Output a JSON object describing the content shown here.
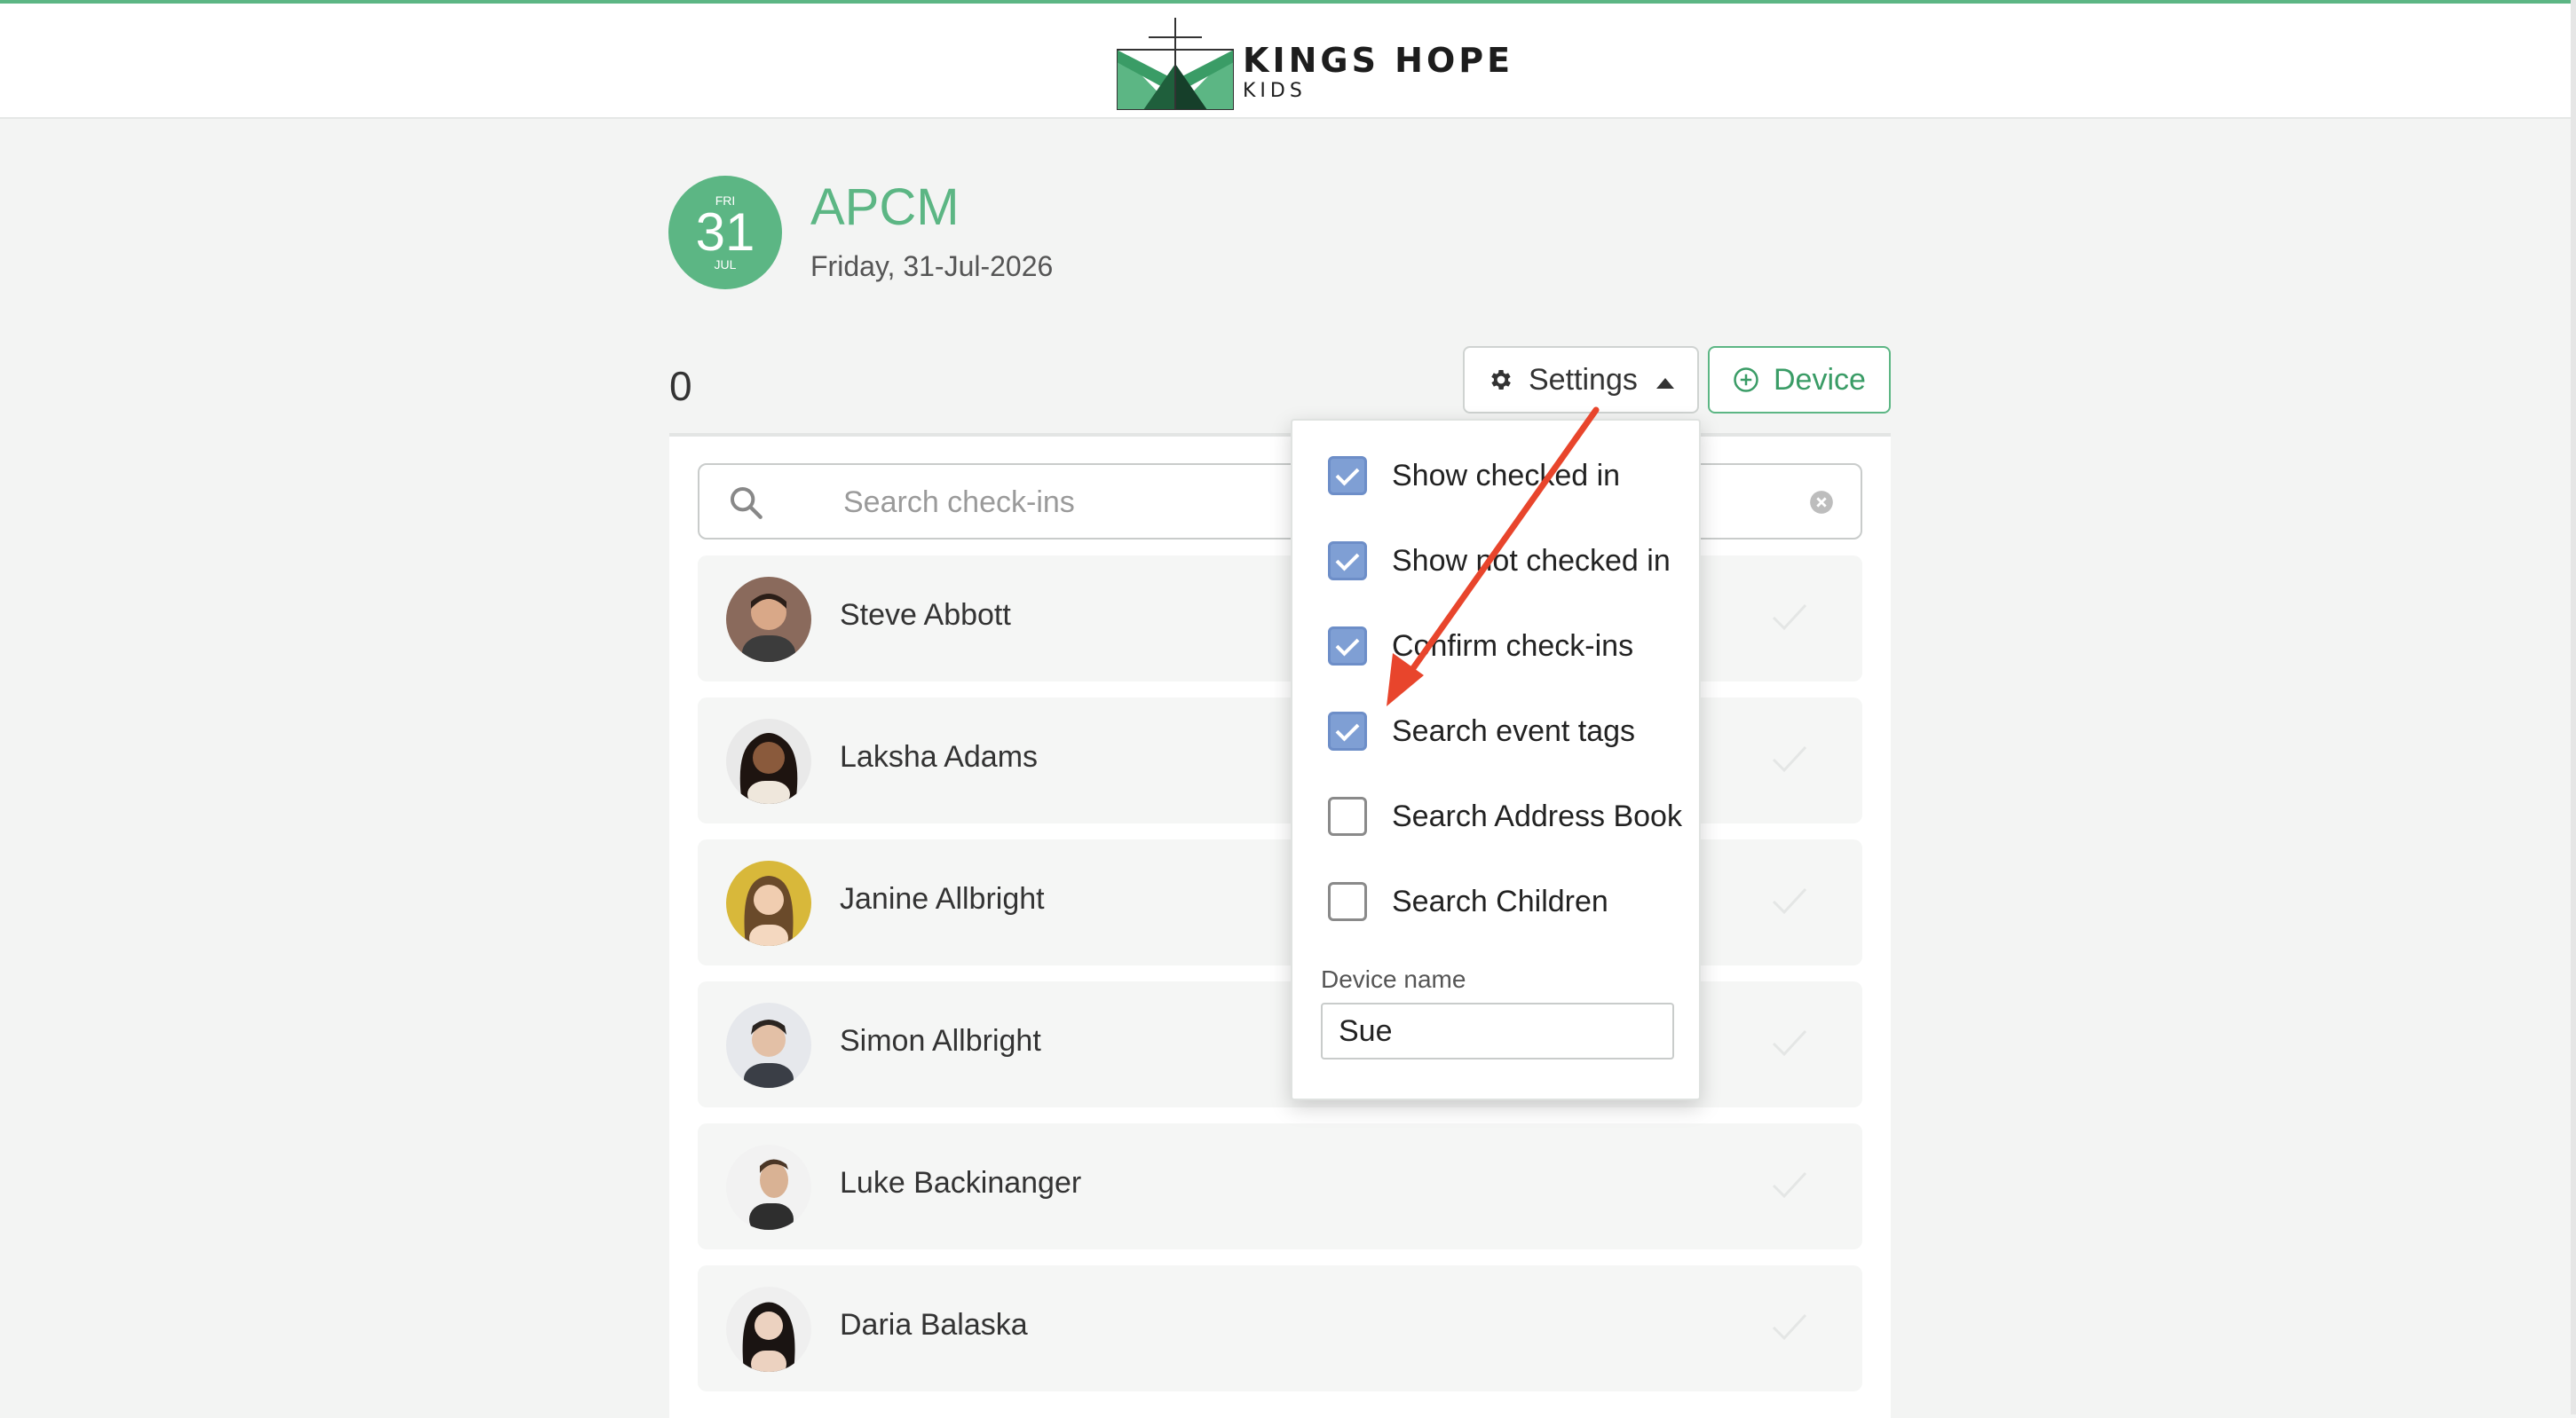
{
  "brand": {
    "title": "KINGS HOPE",
    "subtitle": "KIDS"
  },
  "event": {
    "day_of_week": "FRI",
    "day": "31",
    "month": "JUL",
    "title": "APCM",
    "date": "Friday, 31-Jul-2026"
  },
  "count": "0",
  "toolbar": {
    "settings_label": "Settings",
    "device_label": "Device"
  },
  "search": {
    "placeholder": "Search check-ins",
    "value": ""
  },
  "settings_menu": {
    "options": [
      {
        "label": "Show checked in",
        "checked": true
      },
      {
        "label": "Show not checked in",
        "checked": true
      },
      {
        "label": "Confirm check-ins",
        "checked": true
      },
      {
        "label": "Search event tags",
        "checked": true
      },
      {
        "label": "Search Address Book",
        "checked": false
      },
      {
        "label": "Search Children",
        "checked": false
      }
    ],
    "device_name_label": "Device name",
    "device_name_value": "Sue"
  },
  "people": [
    {
      "name": "Steve Abbott"
    },
    {
      "name": "Laksha Adams"
    },
    {
      "name": "Janine Allbright"
    },
    {
      "name": "Simon Allbright"
    },
    {
      "name": "Luke Backinanger"
    },
    {
      "name": "Daria Balaska"
    }
  ],
  "colors": {
    "accent": "#5cb684",
    "checkbox_checked": "#7f9fd4",
    "annotation_arrow": "#e8452c"
  }
}
